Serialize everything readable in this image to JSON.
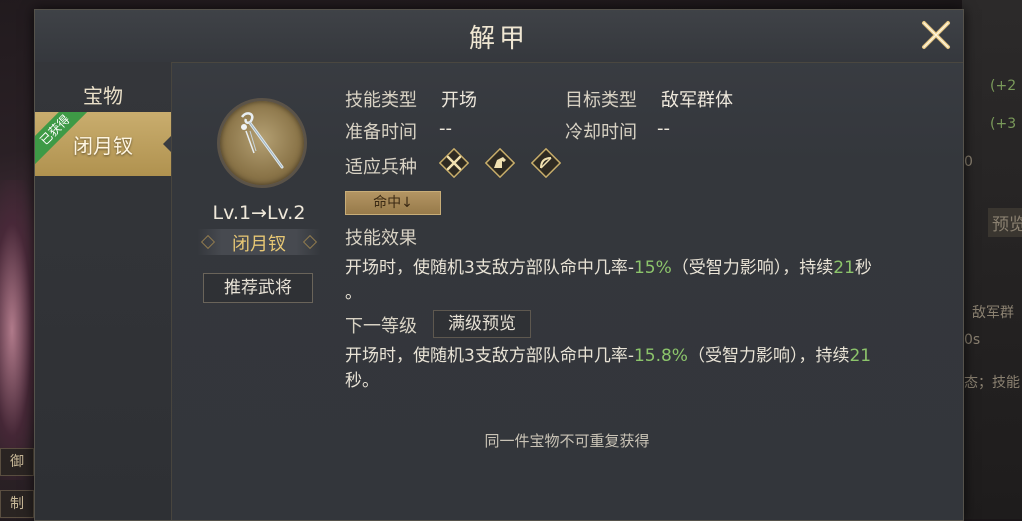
{
  "title": "解甲",
  "tabs": {
    "category": "宝物",
    "items": [
      {
        "label": "闭月钗",
        "badge": "已获得",
        "selected": true
      }
    ]
  },
  "treasure": {
    "icon": "hairpin-icon",
    "level": "Lv.1→Lv.2",
    "name": "闭月钗",
    "recommend_label": "推荐武将"
  },
  "skill": {
    "type_label": "技能类型",
    "type_value": "开场",
    "target_label": "目标类型",
    "target_value": "敌军群体",
    "prep_label": "准备时间",
    "prep_value": "--",
    "cooldown_label": "冷却时间",
    "cooldown_value": "--",
    "troop_label": "适应兵种",
    "troops": [
      "infantry-icon",
      "cavalry-icon",
      "archer-icon"
    ],
    "tag": "命中↓",
    "effect_heading": "技能效果",
    "effect": {
      "pre": "开场时，使随机3支敌方部队命中几率-",
      "pct": "15%",
      "mid": "（受智力影响），持续",
      "dur": "21",
      "post": "秒",
      "end": "。"
    },
    "next_label": "下一等级",
    "preview_label": "满级预览",
    "next_effect": {
      "pre": "开场时，使随机3支敌方部队命中几率-",
      "pct": "15.8%",
      "mid": "（受智力影响），持续",
      "dur": "21",
      "end": "秒。"
    }
  },
  "notice": "同一件宝物不可重复获得",
  "background": {
    "right_texts": [
      "(+2",
      "(+3",
      "0",
      "预览",
      "敌军群",
      "0s",
      "态；技能"
    ],
    "left_tags": [
      "御",
      "制"
    ]
  },
  "colors": {
    "accent_gold": "#c9ad6e",
    "highlight_green": "#8cc46b",
    "badge_green": "#3e9a46"
  }
}
